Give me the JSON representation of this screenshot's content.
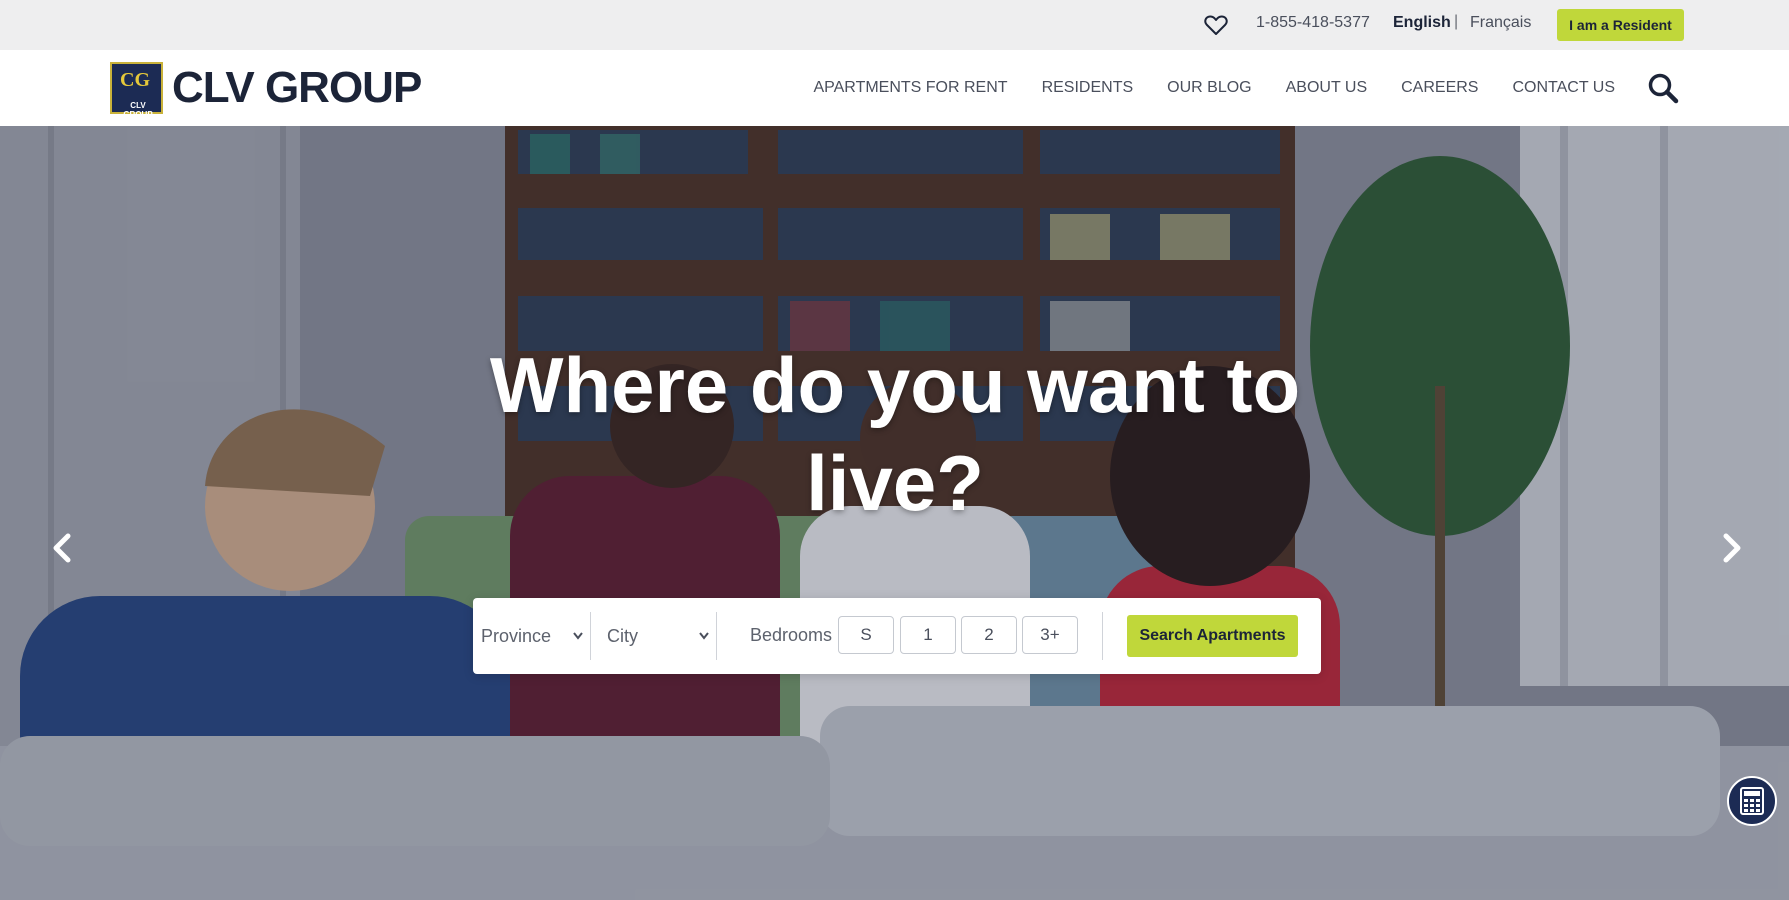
{
  "utility": {
    "phone": "1-855-418-5377",
    "lang_english": "English",
    "lang_separator": "|",
    "lang_french": "Français",
    "resident_button": "I am a Resident"
  },
  "logo": {
    "badge_mark": "CG",
    "badge_text": "CLV GROUP",
    "wordmark": "CLV GROUP"
  },
  "nav": {
    "items": [
      {
        "label": "APARTMENTS FOR RENT"
      },
      {
        "label": "RESIDENTS"
      },
      {
        "label": "OUR BLOG"
      },
      {
        "label": "ABOUT US"
      },
      {
        "label": "CAREERS"
      },
      {
        "label": "CONTACT US"
      }
    ]
  },
  "hero": {
    "title": "Where do you want to live?"
  },
  "search": {
    "province": "Province",
    "city": "City",
    "bedrooms_label": "Bedrooms",
    "bedroom_options": [
      "S",
      "1",
      "2",
      "3+"
    ],
    "submit": "Search Apartments"
  },
  "icons": {
    "favorites": "heart-icon",
    "search": "search-icon",
    "prev": "chevron-left-icon",
    "next": "chevron-right-icon",
    "calculator": "calculator-icon"
  },
  "colors": {
    "accent": "#c0d73a",
    "brand_navy": "#1c2b54",
    "text_dark": "#1c2438",
    "utility_bg": "#eeeeef"
  }
}
